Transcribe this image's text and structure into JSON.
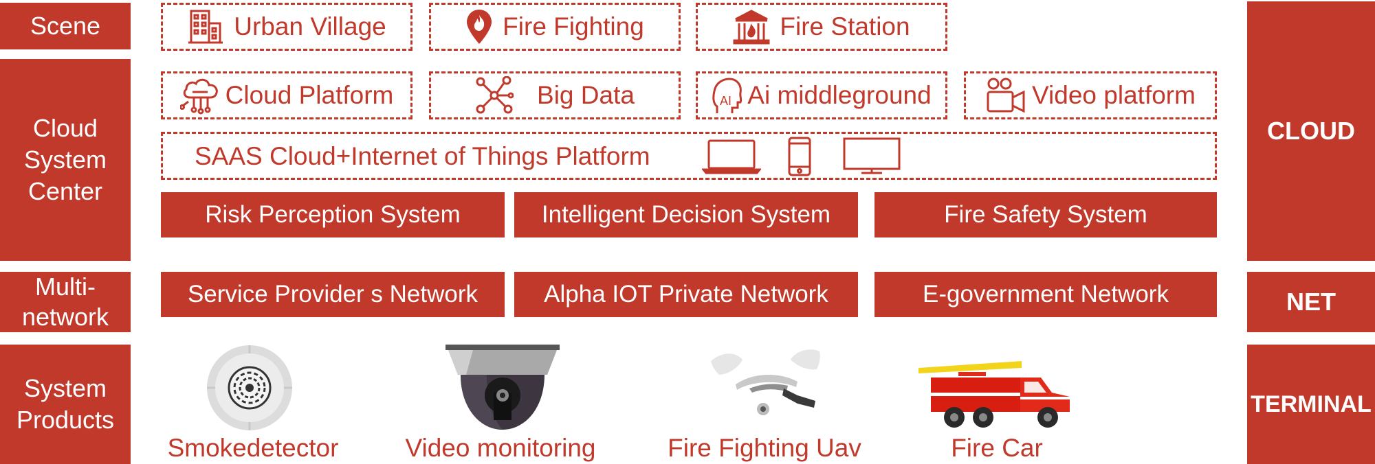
{
  "left_labels": {
    "scene": "Scene",
    "cloud_line1": "Cloud",
    "cloud_line2": "System",
    "cloud_line3": "Center",
    "multi_line1": "Multi-",
    "multi_line2": "network",
    "products_line1": "System",
    "products_line2": "Products"
  },
  "right_labels": {
    "cloud": "CLOUD",
    "net": "NET",
    "terminal": "TERMINAL"
  },
  "scene_items": [
    "Urban Village",
    "Fire Fighting",
    "Fire Station"
  ],
  "platform_items": [
    "Cloud Platform",
    "Big Data",
    "Ai middleground",
    "Video platform"
  ],
  "saas_label": "SAAS Cloud+Internet of Things Platform",
  "systems": [
    "Risk Perception System",
    "Intelligent Decision System",
    "Fire Safety System"
  ],
  "networks": [
    "Service Provider s Network",
    "Alpha IOT Private Network",
    "E-government Network"
  ],
  "products": [
    "Smokedetector",
    "Video monitoring",
    "Fire Fighting Uav",
    "Fire Car"
  ],
  "colors": {
    "accent": "#c0392b",
    "background": "#ffffff"
  },
  "icons": [
    "building-icon",
    "fire-pin-icon",
    "fire-station-icon",
    "cloud-circuit-icon",
    "network-nodes-icon",
    "ai-head-icon",
    "video-camera-icon",
    "laptop-icon",
    "phone-icon",
    "monitor-icon"
  ]
}
